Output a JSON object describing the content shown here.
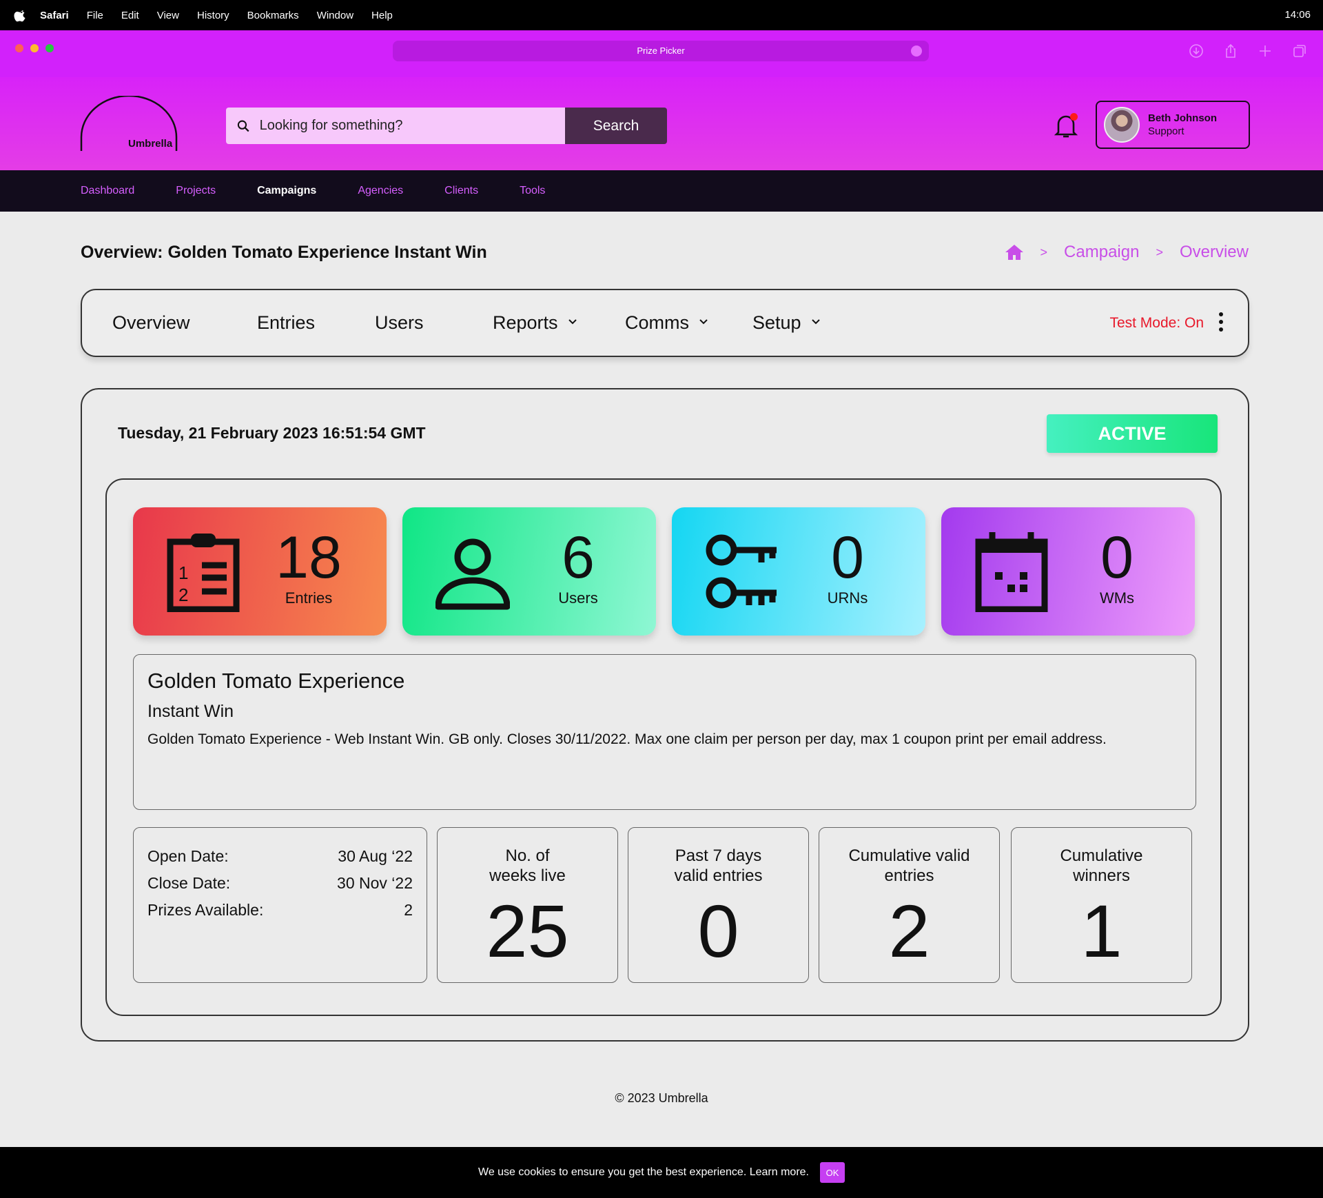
{
  "menubar": {
    "app": "Safari",
    "items": [
      "File",
      "Edit",
      "View",
      "History",
      "Bookmarks",
      "Window",
      "Help"
    ],
    "clock": "14:06"
  },
  "browser": {
    "tab_title": "Prize Picker",
    "traffic_light_colors": [
      "#ff5f57",
      "#febc2e",
      "#28c840"
    ]
  },
  "header": {
    "logo_text": "Umbrella",
    "search_placeholder": "Looking for something?",
    "search_button": "Search",
    "user_name": "Beth Johnson",
    "user_role": "Support"
  },
  "nav": {
    "items": [
      "Dashboard",
      "Projects",
      "Campaigns",
      "Agencies",
      "Clients",
      "Tools"
    ],
    "active": "Campaigns"
  },
  "page": {
    "title": "Overview: Golden Tomato Experience Instant Win",
    "breadcrumb": [
      "home-icon",
      "Campaign",
      "Overview"
    ],
    "breadcrumb_sep": ">"
  },
  "tabs": {
    "items": [
      "Overview",
      "Entries",
      "Users",
      "Reports",
      "Comms",
      "Setup"
    ],
    "test_mode": "Test Mode: On"
  },
  "status": {
    "datetime": "Tuesday, 21 February 2023 16:51:54 GMT",
    "badge": "ACTIVE"
  },
  "stats": [
    {
      "value": "18",
      "label": "Entries",
      "icon": "clipboard-list-icon"
    },
    {
      "value": "6",
      "label": "Users",
      "icon": "user-icon"
    },
    {
      "value": "0",
      "label": "URNs",
      "icon": "keys-icon"
    },
    {
      "value": "0",
      "label": "WMs",
      "icon": "calendar-icon"
    }
  ],
  "campaign": {
    "name": "Golden Tomato Experience",
    "type": "Instant Win",
    "description": "Golden Tomato Experience - Web Instant Win. GB only. Closes 30/11/2022. Max one claim per person per day, max 1 coupon print per email address."
  },
  "details": {
    "open_label": "Open Date:",
    "open_value": "30 Aug ‘22",
    "close_label": "Close Date:",
    "close_value": "30 Nov ‘22",
    "prizes_label": "Prizes Available:",
    "prizes_value": "2"
  },
  "metrics": [
    {
      "title_1": "No. of",
      "title_2": "weeks live",
      "value": "25"
    },
    {
      "title_1": "Past 7 days",
      "title_2": "valid entries",
      "value": "0"
    },
    {
      "title_1": "Cumulative valid",
      "title_2": "entries",
      "value": "2"
    },
    {
      "title_1": "Cumulative",
      "title_2": "winners",
      "value": "1"
    }
  ],
  "footer": "© 2023 Umbrella",
  "cookie": {
    "text": "We use cookies to ensure you get the best experience. Learn more.",
    "button": "OK"
  },
  "colors": {
    "brand": "#d822f8",
    "nav_bg": "#120c1c",
    "accent_text": "#c84ee8",
    "test_mode": "#e8182a",
    "active": "#18e57a"
  }
}
